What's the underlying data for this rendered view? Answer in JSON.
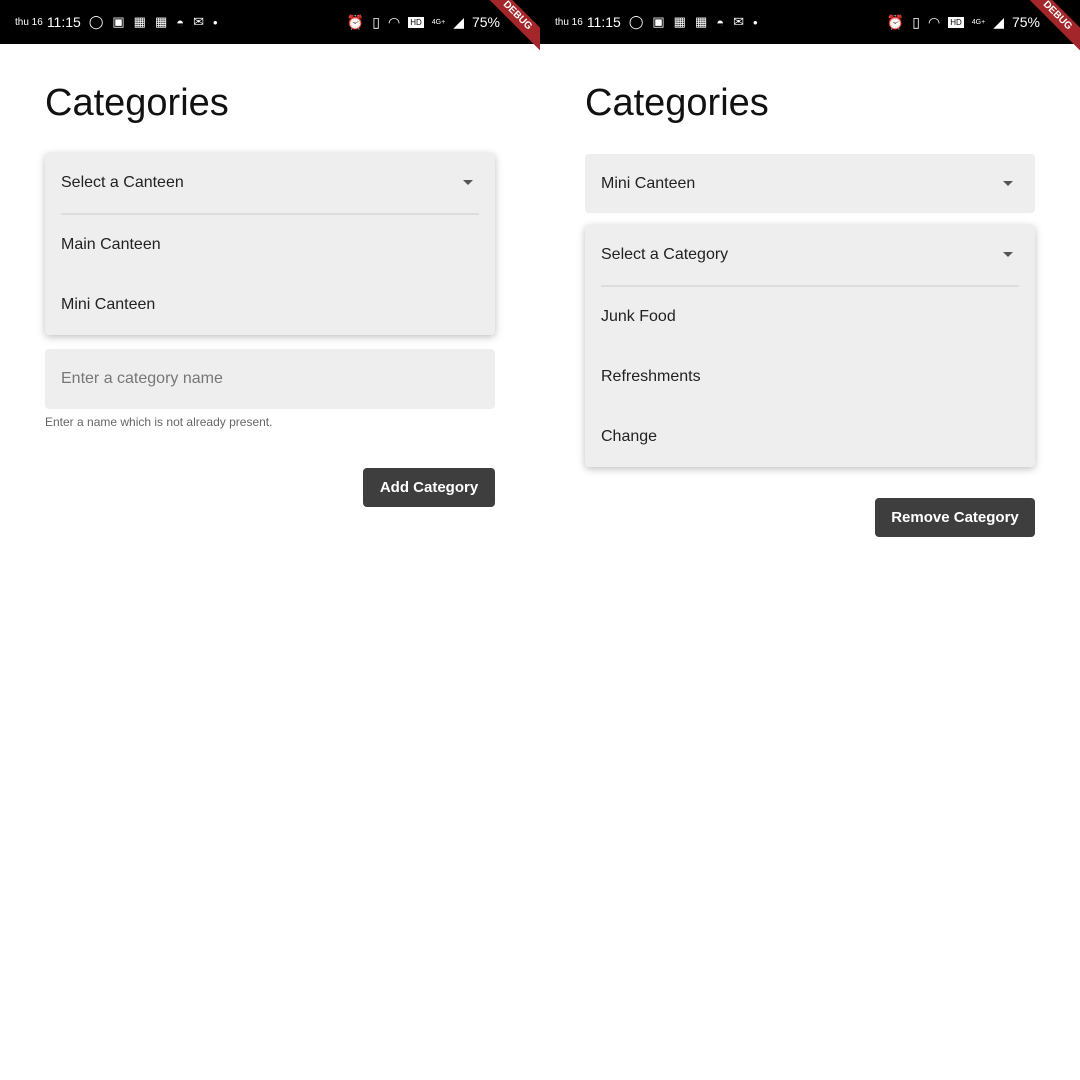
{
  "status_bar": {
    "day": "thu 16",
    "time": "11:15",
    "battery": "75%",
    "network": "4G+",
    "debug_banner": "DEBUG",
    "left_icons": [
      "whatsapp-icon",
      "instagram-icon",
      "calendar-icon",
      "calendar-icon",
      "reddit-icon",
      "gmail-icon",
      "dot-icon"
    ],
    "right_icons": [
      "alarm-icon",
      "vibrate-icon",
      "hotspot-icon",
      "hd-icon",
      "signal-icon"
    ]
  },
  "left": {
    "title": "Categories",
    "canteen_dropdown": {
      "placeholder": "Select a Canteen",
      "options": [
        "Main Canteen",
        "Mini Canteen"
      ]
    },
    "category_input": {
      "placeholder": "Enter a category name",
      "value": ""
    },
    "helper": "Enter a name which is not already present.",
    "button": "Add Category"
  },
  "right": {
    "title": "Categories",
    "canteen_dropdown": {
      "value": "Mini Canteen"
    },
    "category_dropdown": {
      "placeholder": "Select a Category",
      "options": [
        "Junk Food",
        "Refreshments",
        "Change"
      ]
    },
    "button": "Remove Category"
  },
  "colors": {
    "button": "#3e3e3e",
    "field": "#eeeeee",
    "debug": "#a3262a"
  }
}
